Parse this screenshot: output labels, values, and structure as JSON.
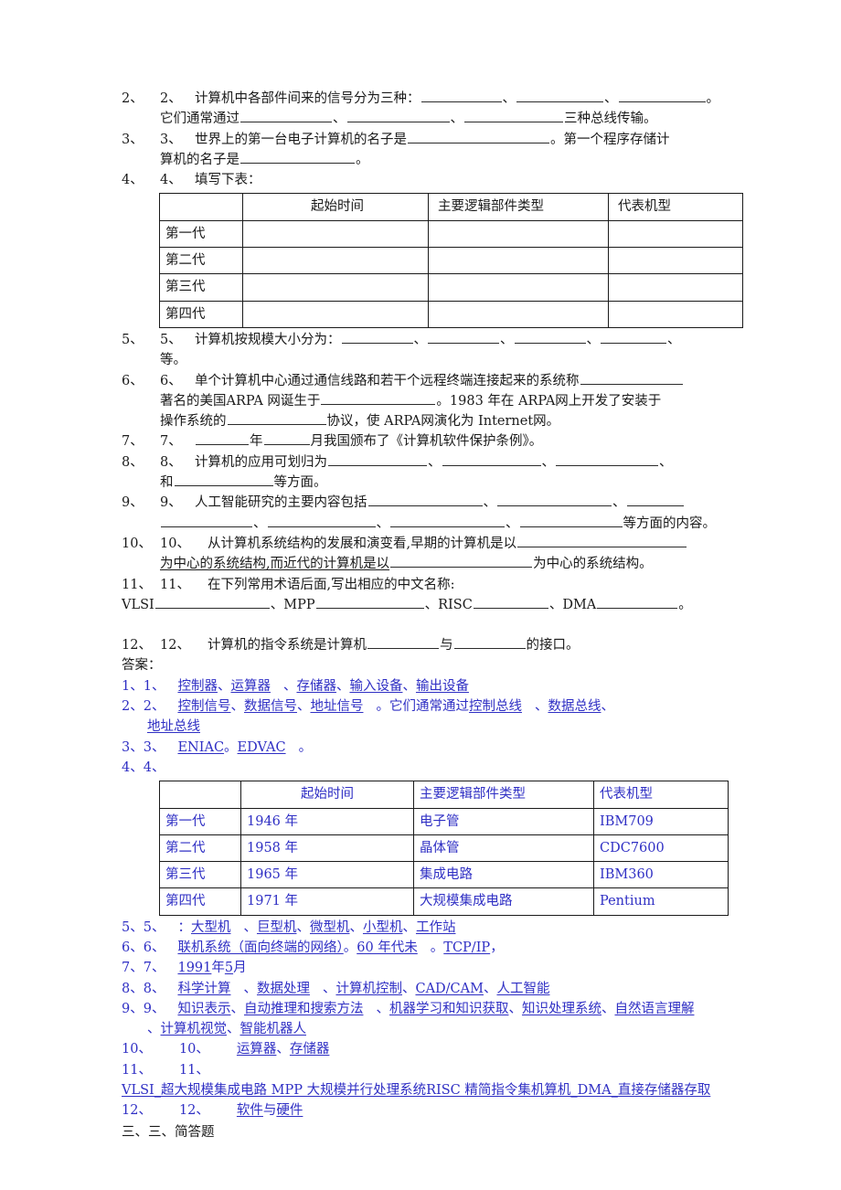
{
  "document": {
    "questions": [
      {
        "id": "q2",
        "outer_num": "2、",
        "inner_num": "2、",
        "text_a": "计算机中各部件间来的信号分为三种：",
        "sep": "、",
        "end": "。",
        "line2_a": "它们通常通过",
        "line2_end": "三种总线传输。"
      },
      {
        "id": "q3",
        "outer_num": "3、",
        "inner_num": "3、",
        "text_a": "世界上的第一台电子计算机的名子是",
        "text_b": "。第一个程序存储计",
        "line2_a": "算机的名子是",
        "line2_end": "。"
      },
      {
        "id": "q4",
        "outer_num": "4、",
        "inner_num": "4、",
        "text_a": "填写下表："
      },
      {
        "id": "q5",
        "outer_num": "5、",
        "inner_num": "5、",
        "text_a": "计算机按规模大小分为：",
        "sep": "、",
        "line2_end": "等。"
      },
      {
        "id": "q6",
        "outer_num": "6、",
        "inner_num": "6、",
        "text_a": "单个计算机中心通过通信线路和若干个远程终端连接起来的系统称",
        "line2_a": "著名的美国ARPA 网诞生于",
        "line2_b": "。1983 年在 ARPA网上开发了安装于",
        "line3_a": "操作系统的",
        "line3_b": "协议，使 ARPA网演化为 Internet网。"
      },
      {
        "id": "q7",
        "outer_num": "7、",
        "inner_num": "7、",
        "text_a": "年",
        "text_b": "月我国颁布了《计算机软件保护条例》。"
      },
      {
        "id": "q8",
        "outer_num": "8、",
        "inner_num": "8、",
        "text_a": "计算机的应用可划归为",
        "sep": "、",
        "line2_a": "和",
        "line2_end": "等方面。"
      },
      {
        "id": "q9",
        "outer_num": "9、",
        "inner_num": "9、",
        "text_a": "人工智能研究的主要内容包括",
        "sep": "、",
        "line2_end": "等方面的内容。"
      },
      {
        "id": "q10",
        "outer_num": "10、",
        "inner_num": "10、",
        "text_a": "从计算机系统结构的发展和演变看,早期的计算机是以",
        "line2_a": "为中心的系统结构,而近代的计算机是以",
        "line2_b": "为中心的系统结构。"
      },
      {
        "id": "q11",
        "outer_num": "11、",
        "inner_num": "11、",
        "text_a": "在下列常用术语后面,写出相应的中文名称:",
        "terms": [
          "VLSI",
          "MPP",
          "RISC",
          "DMA"
        ],
        "sep": "、",
        "end": "。"
      },
      {
        "id": "q12",
        "outer_num": "12、",
        "inner_num": "12、",
        "text_a": "计算机的指令系统是计算机",
        "text_b": "与",
        "text_c": "的接口。"
      }
    ],
    "question_table": {
      "headers": [
        "",
        "起始时间",
        "主要逻辑部件类型",
        "代表机型"
      ],
      "rows": [
        [
          "第一代",
          "",
          "",
          ""
        ],
        [
          "第二代",
          "",
          "",
          ""
        ],
        [
          "第三代",
          "",
          "",
          ""
        ],
        [
          "第四代",
          "",
          "",
          ""
        ]
      ]
    },
    "answers_label": "答案：",
    "answers": [
      {
        "id": "a1",
        "num_a": "1、",
        "num_b": "1、",
        "items": [
          "控制器",
          "运算器",
          "存储器",
          "输入设备",
          "输出设备"
        ],
        "sep": "、"
      },
      {
        "id": "a2",
        "num_a": "2、",
        "num_b": "2、",
        "items": [
          "控制信号",
          "数据信号",
          "地址信号"
        ],
        "mid": "。它们通常通过",
        "items2": [
          "控制总线",
          "数据总线",
          "地址总线"
        ],
        "sep": "、"
      },
      {
        "id": "a3",
        "num_a": "3、",
        "num_b": "3、",
        "items": [
          "ENIAC",
          "EDVAC"
        ],
        "sep1": "。",
        "sep2": "。"
      },
      {
        "id": "a4",
        "num_a": "4、",
        "num_b": "4、"
      },
      {
        "id": "a5",
        "num_a": "5、",
        "num_b": "5、",
        "prefix": "：",
        "items": [
          "大型机",
          "巨型机",
          "微型机",
          "小型机",
          "工作站"
        ],
        "sep": "、"
      },
      {
        "id": "a6",
        "num_a": "6、",
        "num_b": "6、",
        "items": [
          "联机系统（面向终端的网络）",
          "60 年代未",
          "TCP/IP"
        ],
        "sep1": "。",
        "sep2": "。",
        "tail": "，"
      },
      {
        "id": "a7",
        "num_a": "7、",
        "num_b": "7、",
        "year": "1991",
        "year_unit": "年",
        "month": "5",
        "month_unit": "月"
      },
      {
        "id": "a8",
        "num_a": "8、",
        "num_b": "8、",
        "items": [
          "科学计算",
          "数据处理",
          "计算机控制",
          "CAD/CAM",
          "人工智能"
        ],
        "sep": "、"
      },
      {
        "id": "a9",
        "num_a": "9、",
        "num_b": "9、",
        "items": [
          "知识表示",
          "自动推理和搜索方法",
          "机器学习和知识获取",
          "知识处理系统",
          "自然语言理解",
          "计算机视觉",
          "智能机器人"
        ],
        "sep": "、"
      },
      {
        "id": "a10",
        "num_a": "10、",
        "num_b": "10、",
        "items": [
          "运算器",
          "存储器"
        ],
        "sep": "、"
      },
      {
        "id": "a11",
        "num_a": "11、",
        "num_b": "11、",
        "text": "VLSI_超大规模集成电路 MPP 大规模并行处理系统RISC 精简指令集机算机_DMA_直接存储器存取"
      },
      {
        "id": "a12",
        "num_a": "12、",
        "num_b": "12、",
        "items": [
          "软件",
          "硬件"
        ],
        "joiner": "与"
      }
    ],
    "answer_table": {
      "headers": [
        "",
        "起始时间",
        "主要逻辑部件类型",
        "代表机型"
      ],
      "rows": [
        [
          "第一代",
          "1946 年",
          "电子管",
          "IBM709"
        ],
        [
          "第二代",
          "1958 年",
          "晶体管",
          "CDC7600"
        ],
        [
          "第三代",
          "1965 年",
          "集成电路",
          "IBM360"
        ],
        [
          "第四代",
          "1971 年",
          "大规模集成电路",
          "Pentium"
        ]
      ]
    },
    "section_tail": "三、三、简答题",
    "colors": {
      "answer_blue": "#2f2fc4",
      "text_black": "#1a1a1a"
    }
  }
}
